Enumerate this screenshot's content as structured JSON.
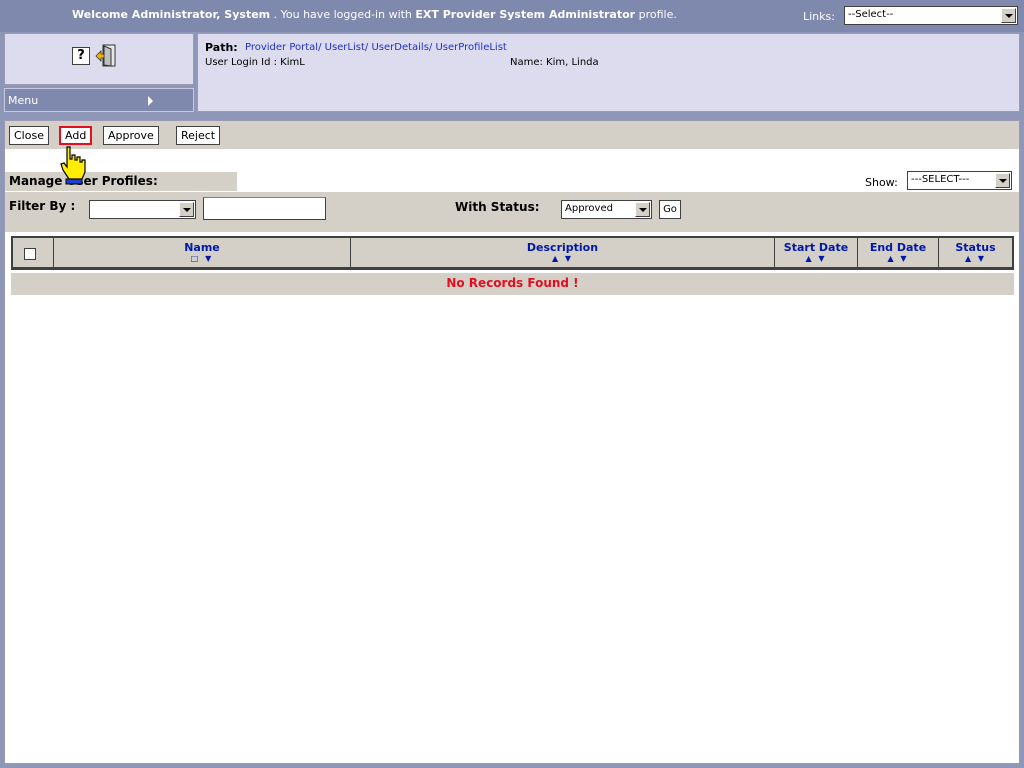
{
  "header": {
    "welcome_prefix": "Welcome Administrator, System",
    "welcome_mid": ". You have logged-in with",
    "profile_name": "EXT Provider System Administrator",
    "welcome_suffix": "profile.",
    "links_label": "Links:",
    "links_selected": "--Select--"
  },
  "icons": {
    "help": "?",
    "exit": "exit-door-icon"
  },
  "menu": {
    "label": "Menu"
  },
  "path": {
    "label": "Path:",
    "value": "Provider Portal/ UserList/ UserDetails/ UserProfileList",
    "login": "User Login Id : KimL",
    "name": "Name: Kim, Linda"
  },
  "toolbar": {
    "close": "Close",
    "add": "Add",
    "approve": "Approve",
    "reject": "Reject"
  },
  "section": {
    "title": "Manage User Profiles:",
    "show_label": "Show:",
    "show_selected": "---SELECT---"
  },
  "filter": {
    "label": "Filter By :",
    "selected": "",
    "input_value": "",
    "status_label": "With Status:",
    "status_selected": "Approved",
    "go_label": "Go"
  },
  "table": {
    "columns": [
      {
        "title": "Name",
        "arrows": "□ ▼"
      },
      {
        "title": "Description",
        "arrows": "▲ ▼"
      },
      {
        "title": "Start Date",
        "arrows": "▲ ▼"
      },
      {
        "title": "End Date",
        "arrows": "▲ ▼"
      },
      {
        "title": "Status",
        "arrows": "▲ ▼"
      }
    ],
    "empty_message": "No Records Found !"
  },
  "colors": {
    "header_bg": "#7f88ad",
    "panel_bg": "#dcdcee",
    "link_blue": "#2030c8",
    "column_blue": "#0018a8",
    "alert_red": "#e01020"
  }
}
